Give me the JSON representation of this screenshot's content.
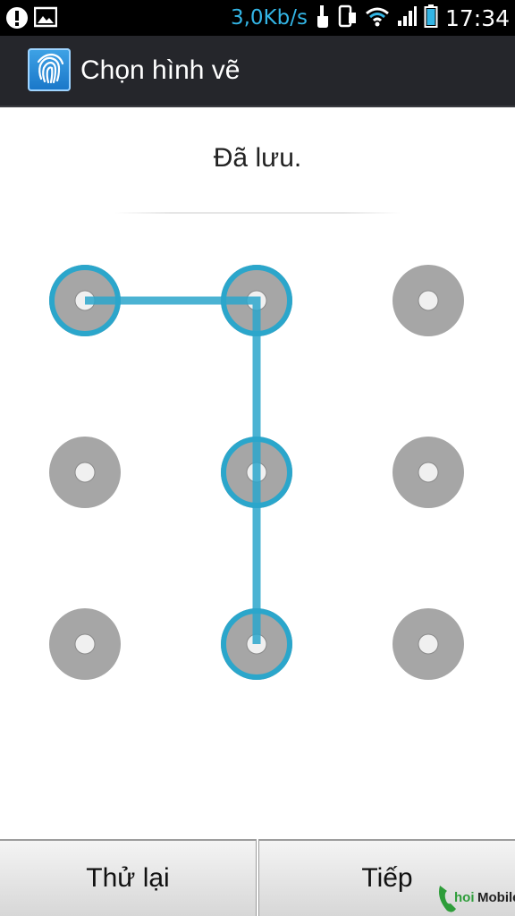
{
  "status_bar": {
    "icons_left": [
      "alert-icon",
      "image-icon"
    ],
    "speed": "3,0Kb/s",
    "icons_right": [
      "touch-icon",
      "phone-rotate-icon",
      "wifi-icon",
      "signal-icon",
      "battery-icon"
    ],
    "time": "17:34"
  },
  "action_bar": {
    "icon": "fingerprint-icon",
    "title": "Chọn hình vẽ"
  },
  "message": "Đã lưu.",
  "pattern": {
    "grid_size": 3,
    "selected_sequence": [
      1,
      2,
      5,
      8
    ],
    "colors": {
      "ring": "#2ba6cb",
      "line": "#2ba6cb",
      "dot_bg": "#a6a6a6",
      "dot_center": "#f0f0f0"
    }
  },
  "buttons": {
    "retry": "Thử lại",
    "next": "Tiếp"
  },
  "watermark": "hoiMobile"
}
